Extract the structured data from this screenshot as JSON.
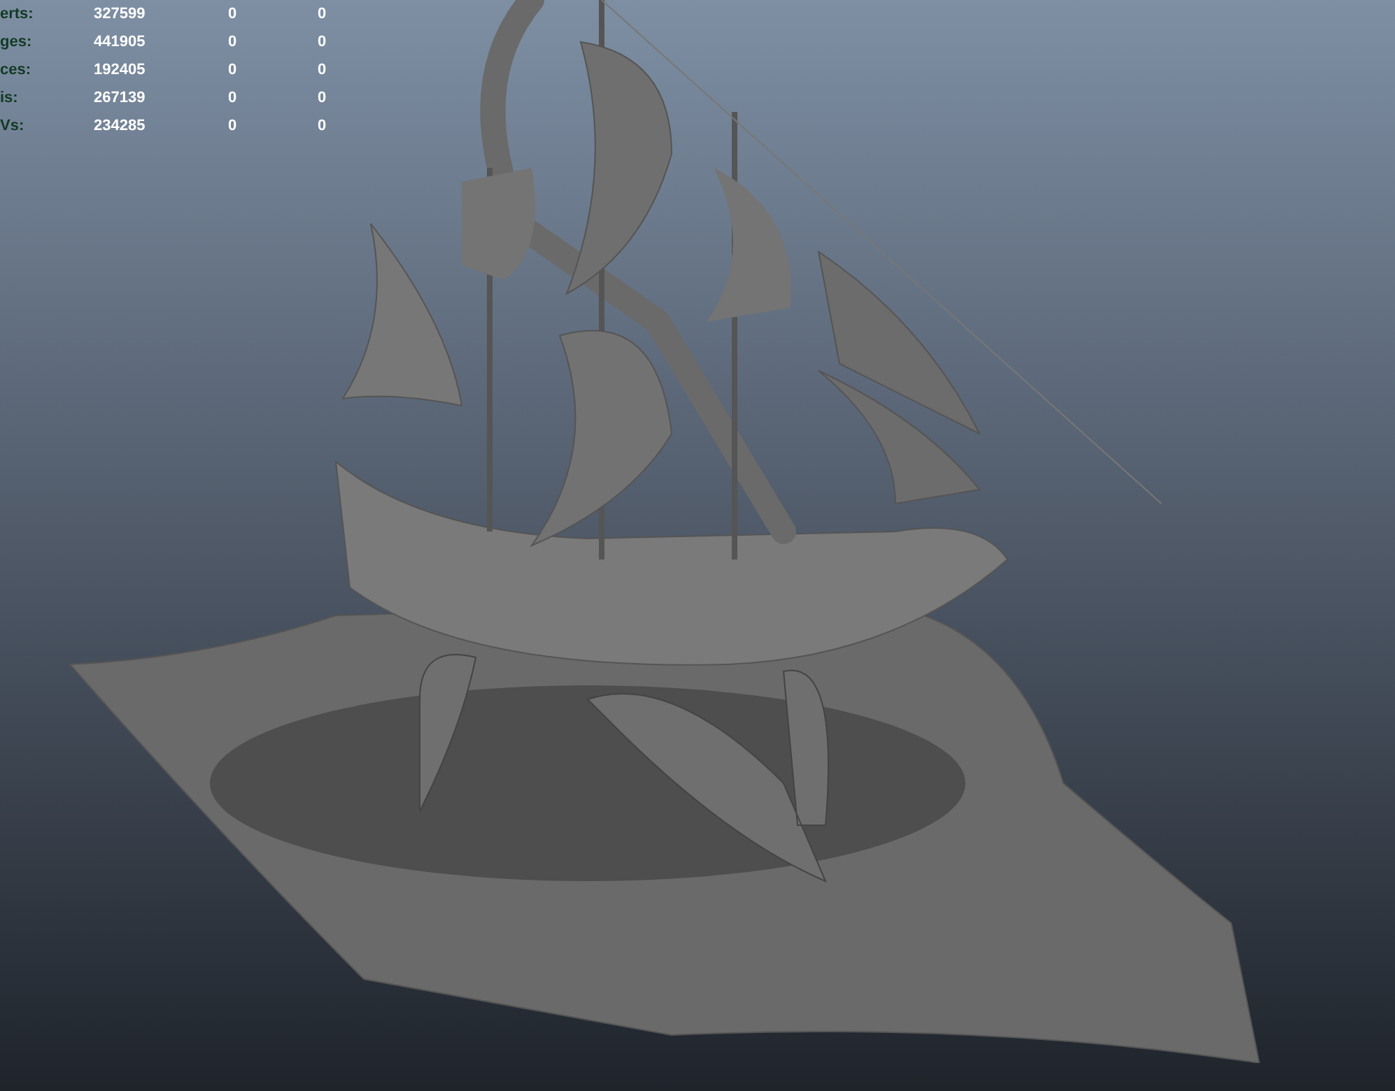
{
  "viewport": {
    "hud_stats": [
      {
        "label": "erts:",
        "values": [
          "327599",
          "0",
          "0"
        ]
      },
      {
        "label": "ges:",
        "values": [
          "441905",
          "0",
          "0"
        ]
      },
      {
        "label": "ces:",
        "values": [
          "192405",
          "0",
          "0"
        ]
      },
      {
        "label": "is:",
        "values": [
          "267139",
          "0",
          "0"
        ]
      },
      {
        "label": "Vs:",
        "values": [
          "234285",
          "0",
          "0"
        ]
      }
    ]
  }
}
